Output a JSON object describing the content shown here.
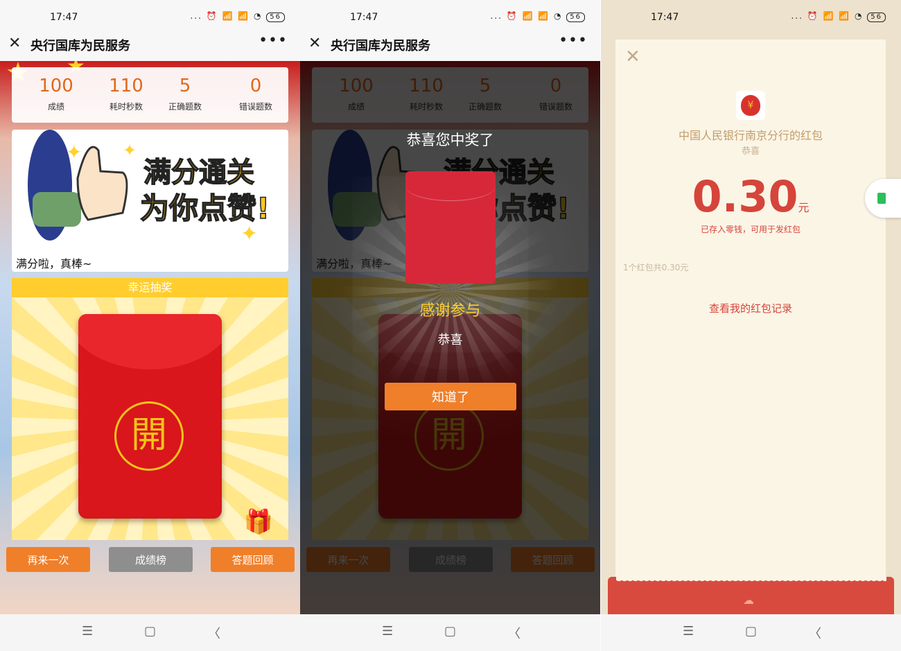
{
  "status": {
    "time": "17:47",
    "icons": "... ⏰ 📶 📶 ◔",
    "battery": "56"
  },
  "titlebar": {
    "close_icon": "✕",
    "title": "央行国库为民服务",
    "more_icon": "•••"
  },
  "stats": [
    {
      "value": "100",
      "label": "成绩"
    },
    {
      "value": "110",
      "label": "耗时秒数"
    },
    {
      "value": "5",
      "label": "正确题数"
    },
    {
      "value": "0",
      "label": "错误题数"
    }
  ],
  "banner": {
    "line1": "满分通关",
    "line2": "为你点赞!",
    "message": "满分啦，真棒~"
  },
  "lottery": {
    "header": "幸运抽奖",
    "seal": "開"
  },
  "buttons": {
    "retry": "再来一次",
    "rank": "成绩榜",
    "review": "答题回顾"
  },
  "modal": {
    "title": "恭喜您中奖了",
    "thanks": "感谢参与",
    "sub": "恭喜",
    "ok": "知道了"
  },
  "redpacket": {
    "from": "中国人民银行南京分行的红包",
    "wish": "恭喜",
    "amount": "0.30",
    "unit": "元",
    "saved": "已存入零钱，可用于发红包",
    "summary": "1个红包共0.30元",
    "record": "查看我的红包记录"
  },
  "nav": {
    "menu": "☰",
    "home": "▢",
    "back": "〈"
  }
}
